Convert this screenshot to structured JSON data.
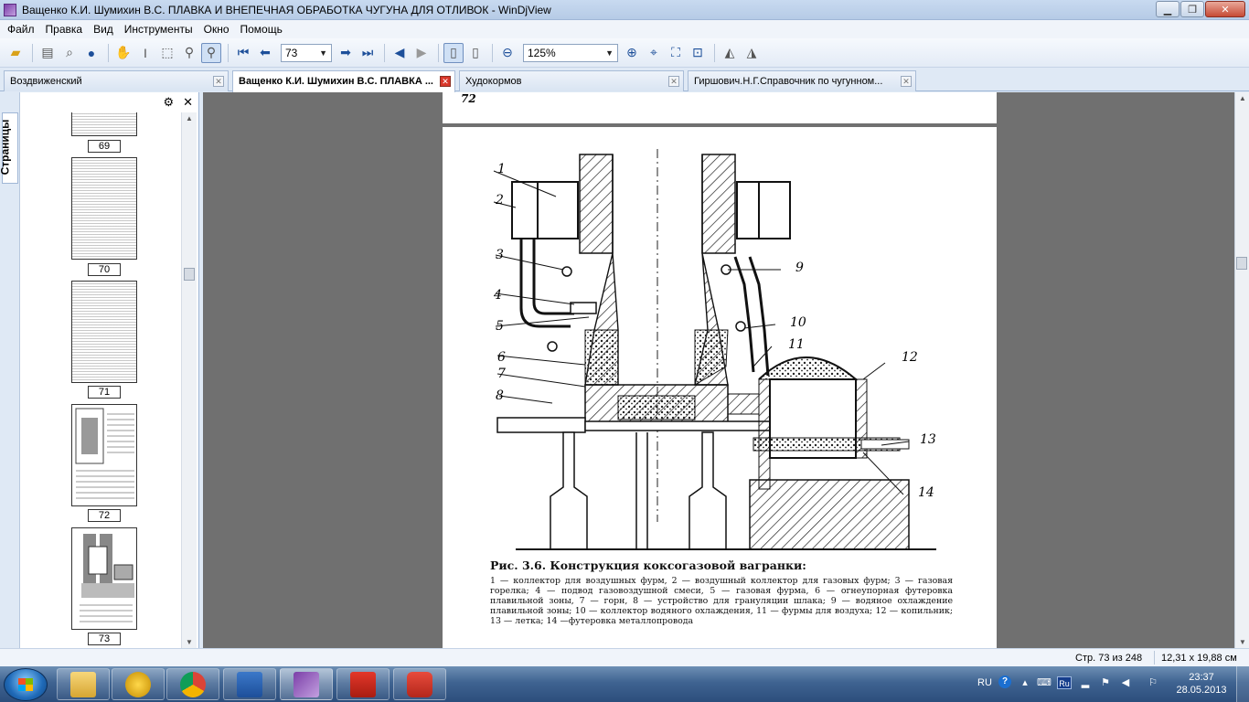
{
  "window": {
    "title": "Ващенко К.И. Шумихин В.С. ПЛАВКА И ВНЕПЕЧНАЯ ОБРАБОТКА ЧУГУНА ДЛЯ ОТЛИВОК - WinDjView"
  },
  "menu": [
    "Файл",
    "Правка",
    "Вид",
    "Инструменты",
    "Окно",
    "Помощь"
  ],
  "toolbar": {
    "page_value": "73",
    "zoom_value": "125%"
  },
  "tabs": [
    {
      "label": "Воздвиженский"
    },
    {
      "label": "Ващенко К.И. Шумихин В.С. ПЛАВКА ..."
    },
    {
      "label": "Худокормов"
    },
    {
      "label": "Гиршович.Н.Г.Справочник по чугунном..."
    }
  ],
  "sidebar": {
    "tab_label": "Страницы",
    "thumbnails": [
      {
        "page": "69"
      },
      {
        "page": "70"
      },
      {
        "page": "71"
      },
      {
        "page": "72"
      },
      {
        "page": "73"
      }
    ]
  },
  "document": {
    "prev_page_number": "72",
    "figure_callouts": [
      "1",
      "2",
      "3",
      "4",
      "5",
      "6",
      "7",
      "8",
      "9",
      "10",
      "11",
      "12",
      "13",
      "14"
    ],
    "caption_title": "Рис. 3.6. Конструкция коксогазовой вагранки:",
    "caption_text": "1 — коллектор для воздушных фурм, 2 — воздушный коллектор для газовых фурм; 3 — газовая горелка; 4 — подвод газовоздушной смеси, 5 — газовая фурма, 6 — огнеупорная футеровка плавильной зоны, 7 — горн, 8 — устройство для грануляции шлака; 9 — водяное охлаждение плавильной зоны; 10 — коллектор водяного охлаждения, 11 — фурмы для воздуха; 12 — копильник; 13 — летка; 14 —футеровка металлопровода"
  },
  "status": {
    "page_info": "Стр. 73 из 248",
    "page_size": "12,31 x 19,88 см"
  },
  "taskbar": {
    "language": "RU",
    "lang_indicator": "Ru",
    "time": "23:37",
    "date": "28.05.2013"
  }
}
